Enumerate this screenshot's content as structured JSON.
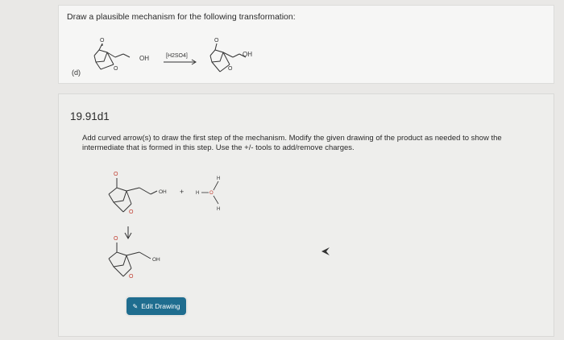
{
  "question": {
    "prompt": "Draw a plausible mechanism for the following transformation:",
    "part_label": "(d)",
    "reagent": "[H2SO4]",
    "starting_material": {
      "oxygen_label": "O",
      "oh_label": "OH"
    },
    "product": {
      "oxygen_label": "O",
      "oh_label": "OH"
    }
  },
  "step": {
    "id": "19.91d1",
    "instructions": "Add curved arrow(s) to draw the first step of the mechanism. Modify the given drawing of the product as needed to show the intermediate that is formed in this step. Use the +/- tools to add/remove charges.",
    "reactant_oh": "OH",
    "plus_sign": "+",
    "hydronium_h": "H",
    "hydronium_o": "O",
    "product_oh": "OH",
    "edit_button": "Edit Drawing"
  },
  "colors": {
    "button": "#1f6d8f",
    "panel": "#f6f6f5",
    "background": "#e9e8e6",
    "atom_red": "#c0392b"
  }
}
